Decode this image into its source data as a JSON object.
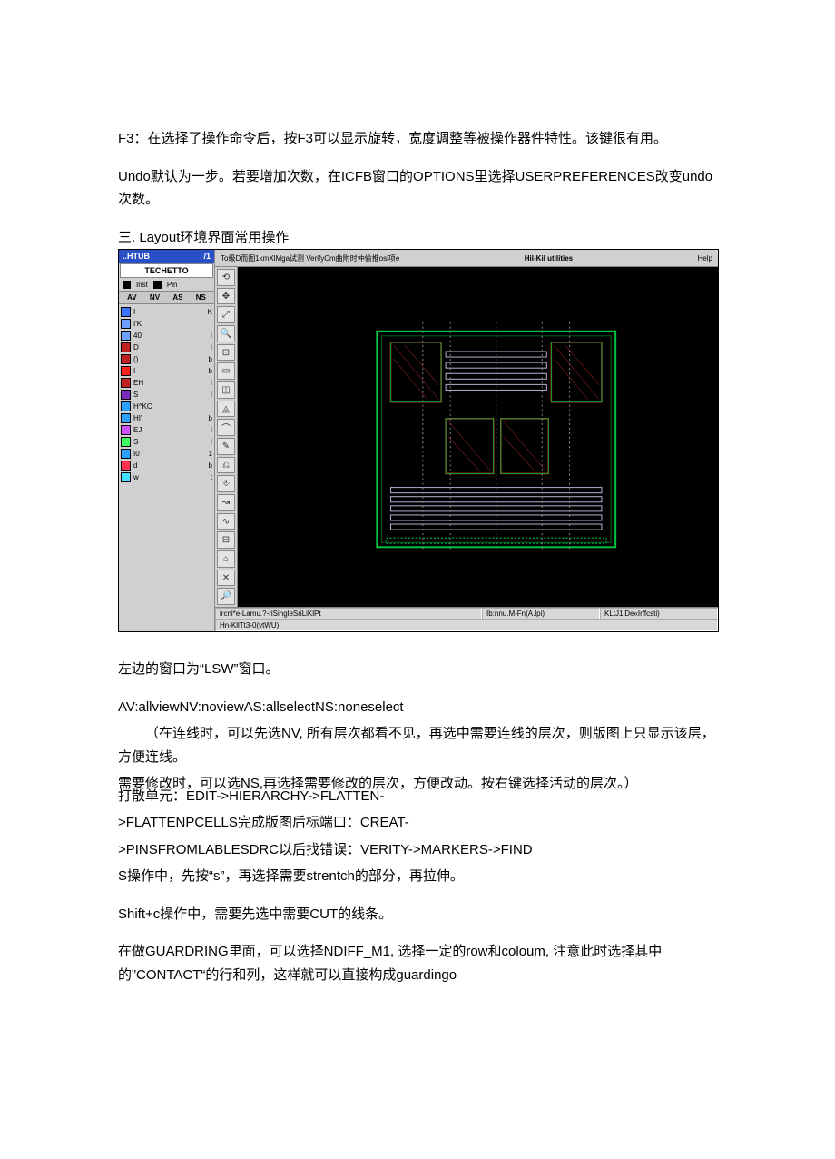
{
  "paragraphs": {
    "p1": "F3：在选择了操作命令后，按F3可以显示旋转，宽度调整等被操作器件特性。该键很有用。",
    "p2": "Undo默认为一步。若要增加次数，在ICFB窗口的OPTIONS里选择USERPREFERENCES改变undo次数。",
    "section": "三. Layout环境界面常用操作",
    "p3": "左边的窗口为“LSW”窗口。",
    "p4": "AV:allviewNV:noviewAS:allselectNS:noneselect",
    "p5": "（在连线时，可以先选NV, 所有层次都看不见，再选中需要连线的层次，则版图上只显示该层，方便连线。",
    "p6": "需要修改时，可以选NS,再选择需要修改的层次，方便改动。按右键选择活动的层次。）",
    "p6b": "打散单元：EDIT->HIERARCHY->FLATTEN-",
    "p7": ">FLATTENPCELLS完成版图后标端口：CREAT-",
    "p8": ">PINSFROMLABLESDRC以后找错误：VERITY->MARKERS->FIND",
    "p9": "S操作中，先按“s”，再选择需要strentch的部分，再拉伸。",
    "p10": "Shift+c操作中，需要先选中需要CUT的线条。",
    "p11": "在做GUARDRING里面，可以选择NDIFF_M1, 选择一定的row和coloum, 注意此时选择其中的”CONTACT“的行和列，这样就可以直接构成guardingo"
  },
  "lsw": {
    "header_left": "..HTUB",
    "header_right": "/1",
    "title": "TECHETTO",
    "cat_labels": [
      "Inst",
      "Pin"
    ],
    "av_labels": [
      "AV",
      "NV",
      "AS",
      "NS"
    ],
    "layers": [
      {
        "color": "#3a74ff",
        "label": "I",
        "label2": "K"
      },
      {
        "color": "#6fa0ff",
        "label": "I'K",
        "label2": ""
      },
      {
        "color": "#6fa0ff",
        "label": "40",
        "label2": "I"
      },
      {
        "color": "#c02020",
        "label": "D",
        "label2": "I"
      },
      {
        "color": "#c02020",
        "label": "()",
        "label2": "b"
      },
      {
        "color": "#ff2020",
        "label": "I",
        "label2": "b"
      },
      {
        "color": "#c02020",
        "label": "EH",
        "label2": "I"
      },
      {
        "color": "#7a2cc0",
        "label": "S",
        "label2": "I"
      },
      {
        "color": "#2aa0ff",
        "label": "H^KC",
        "label2": ""
      },
      {
        "color": "#2aa0ff",
        "label": "HI'",
        "label2": "b"
      },
      {
        "color": "#d050ff",
        "label": "EJ",
        "label2": "I"
      },
      {
        "color": "#40ff60",
        "label": "S",
        "label2": "I"
      },
      {
        "color": "#2aa0ff",
        "label": "I0",
        "label2": "1"
      },
      {
        "color": "#ff3050",
        "label": "d",
        "label2": "b"
      },
      {
        "color": "#40e0ff",
        "label": "w",
        "label2": "t"
      }
    ]
  },
  "editor": {
    "menu_left": "To级D而图1kmXlMga试测 VerifyCm曲附时仲偷推osi项e",
    "menu_mid": "Hil-Kil utilities",
    "menu_right": "Help",
    "tool_icons": [
      "⟲",
      "✥",
      "⤢",
      "🔍",
      "⊡",
      "▭",
      "◫",
      "◬",
      "⌒",
      "✎",
      "⎌",
      "⎀",
      "↝",
      "∿",
      "⊟",
      "⌂",
      "✕",
      "🔎"
    ]
  },
  "status": {
    "cell1": "ircni*e-Lamu.?-riSingleSriLiKlPt",
    "cell2": "Ib:nnu.M-Fn(A.lpi)",
    "cell3": "KLtJ1iDe«Irffcsti)",
    "bottom": "Hn-KllTt3-0(ytWU)"
  }
}
